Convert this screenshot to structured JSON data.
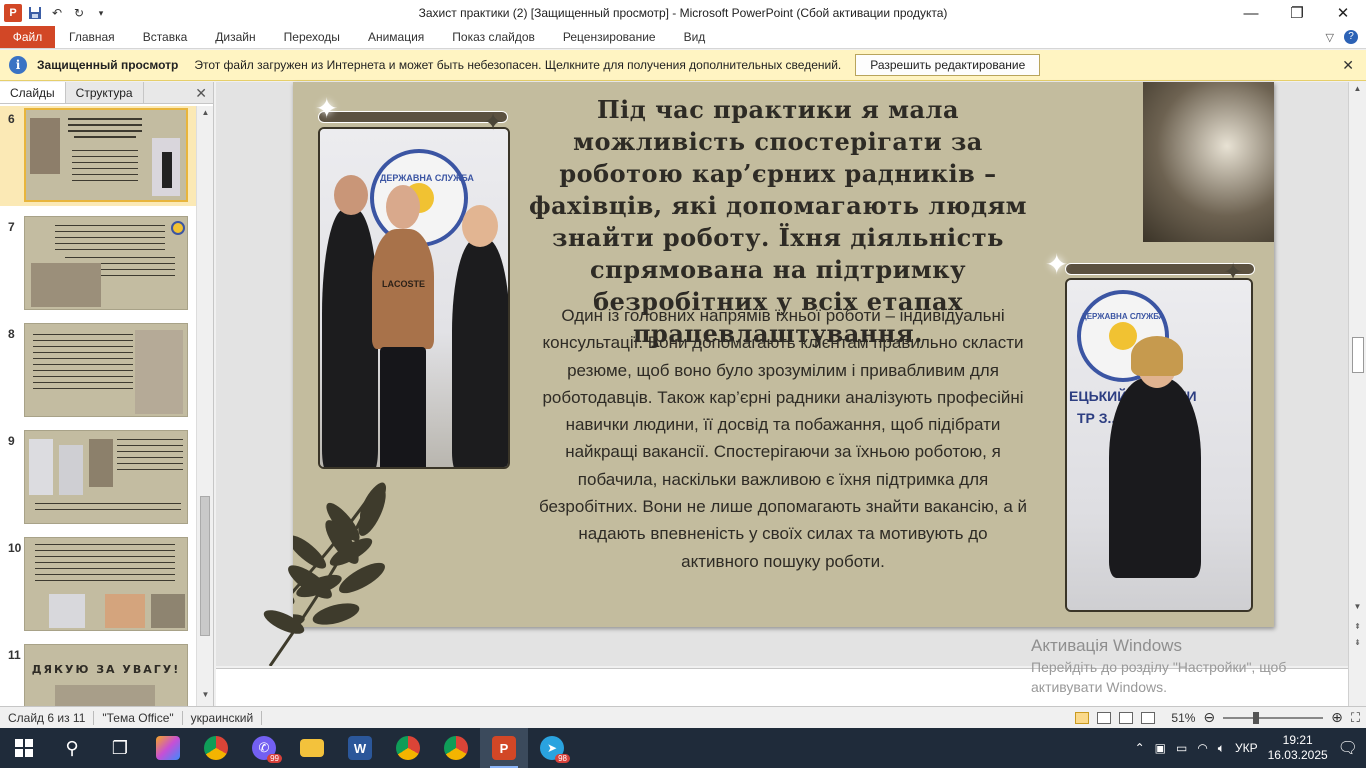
{
  "window": {
    "title": "Захист практики (2) [Защищенный просмотр]  -  Microsoft PowerPoint (Сбой активации продукта)",
    "app_icon": "P",
    "minimize_icon": "—",
    "maximize_icon": "❐",
    "close_icon": "✕"
  },
  "ribbon": {
    "file_tab": "Файл",
    "tabs": [
      "Главная",
      "Вставка",
      "Дизайн",
      "Переходы",
      "Анимация",
      "Показ слайдов",
      "Рецензирование",
      "Вид"
    ]
  },
  "protected_bar": {
    "title": "Защищенный просмотр",
    "message": "Этот файл загружен из Интернета и может быть небезопасен. Щелкните для получения дополнительных сведений.",
    "enable_button": "Разрешить редактирование"
  },
  "left_pane": {
    "tabs": [
      "Слайды",
      "Структура"
    ],
    "slide_numbers": [
      "6",
      "7",
      "8",
      "9",
      "10",
      "11"
    ],
    "selected": "6"
  },
  "slide": {
    "heading": "Під час практики я мала можливість спостерігати за роботою кар’єрних радників – фахівців, які допомагають людям знайти роботу. Їхня діяльність спрямована на підтримку безробітних у всіх етапах працевлаштування.",
    "body": "Один із головних напрямів їхньої роботи – індивідуальні консультації.  Вони допомагають клієнтам правильно скласти резюме, щоб воно було зрозумілим і привабливим для роботодавців. Також кар’єрні радники аналізують професійні навички людини, її досвід та побажання, щоб підібрати найкращі вакансії. Спостерігаючи  за їхньою роботою, я побачила, наскільки важливою є їхня підтримка для безробітних. Вони не лише допомагають знайти вакансію, а й надають впевненість у своїх силах та мотивують до активного пошуку роботи.",
    "banner_text_1": "ДЕРЖАВНА СЛУЖБА",
    "banner_text_2": "ЕЦЬКИЙ ... ЛАСНИ",
    "banner_text_3": "ТР З...СТІ",
    "shirt_text": "LACOSTE"
  },
  "thumb11_text": "ДЯКУЮ  ЗА  УВАГУ!",
  "watermark": {
    "line1": "Активація Windows",
    "line2": "Перейдіть до розділу \"Настройки\", щоб",
    "line3": "активувати Windows."
  },
  "status": {
    "slide_info": "Слайд 6 из 11",
    "theme": "\"Тема Office\"",
    "language": "украинский",
    "zoom": "51%"
  },
  "taskbar": {
    "time": "19:21",
    "date": "16.03.2025",
    "lang": "УКР",
    "badge_viber": "99",
    "badge_telegram": "98"
  },
  "colors": {
    "accent": "#d24726",
    "slide_bg": "#c3bc9e",
    "protected_bar": "#fff4c2"
  }
}
